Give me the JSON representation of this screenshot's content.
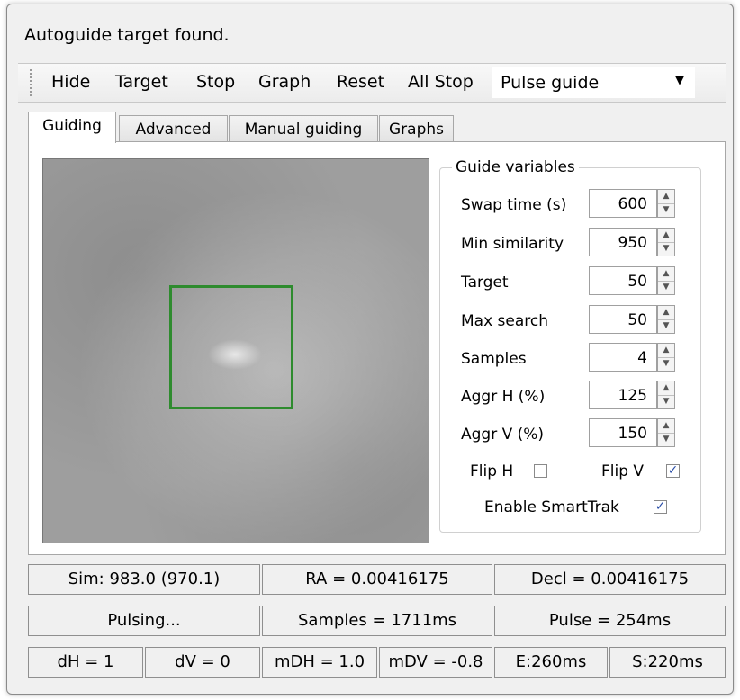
{
  "window": {
    "title": "Autoguide target found."
  },
  "toolbar": {
    "buttons": [
      "Hide",
      "Target",
      "Stop",
      "Graph",
      "Reset",
      "All Stop"
    ],
    "mode_select": "Pulse guide"
  },
  "tabs": [
    "Guiding",
    "Advanced",
    "Manual guiding",
    "Graphs"
  ],
  "guide_variables": {
    "legend": "Guide variables",
    "rows": [
      {
        "label": "Swap time (s)",
        "value": "600"
      },
      {
        "label": "Min similarity",
        "value": "950"
      },
      {
        "label": "Target",
        "value": "50"
      },
      {
        "label": "Max search",
        "value": "50"
      },
      {
        "label": "Samples",
        "value": "4"
      },
      {
        "label": "Aggr H (%)",
        "value": "125"
      },
      {
        "label": "Aggr V (%)",
        "value": "150"
      }
    ],
    "flip_h": {
      "label": "Flip H",
      "checked": false
    },
    "flip_v": {
      "label": "Flip V",
      "checked": true
    },
    "smarttrak": {
      "label": "Enable SmartTrak",
      "checked": true
    }
  },
  "status": {
    "row1": [
      "Sim: 983.0 (970.1)",
      "RA = 0.00416175",
      "Decl = 0.00416175"
    ],
    "row2": [
      "Pulsing...",
      "Samples = 1711ms",
      "Pulse = 254ms"
    ],
    "row3": [
      "dH = 1",
      "dV = 0",
      "mDH = 1.0",
      "mDV = -0.8",
      "E:260ms",
      "S:220ms"
    ]
  },
  "check_mark": "✓"
}
